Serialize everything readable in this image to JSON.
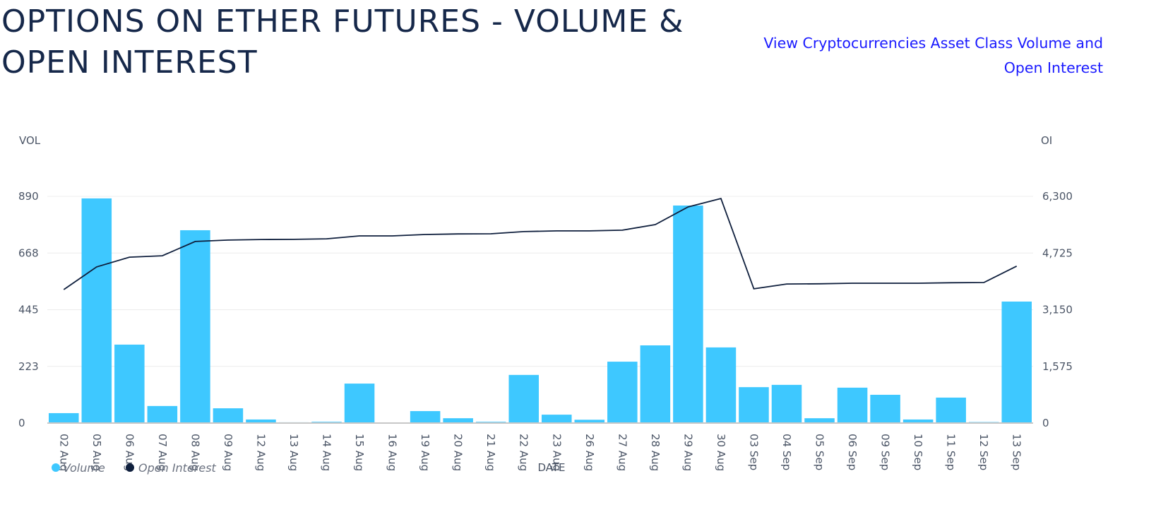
{
  "header": {
    "title": "OPTIONS ON ETHER FUTURES - VOLUME & OPEN INTEREST",
    "link_label": "View Cryptocurrencies Asset Class Volume and Open Interest"
  },
  "colors": {
    "volume": "#3ec8ff",
    "open_interest": "#0f1f3d",
    "title": "#16284a",
    "link": "#1a1aff",
    "gridline": "#ececec",
    "axis_text": "#4b5566"
  },
  "chart_data": {
    "type": "bar",
    "title": "OPTIONS ON ETHER FUTURES - VOLUME & OPEN INTEREST",
    "xlabel": "DATE",
    "ylabel": "VOL",
    "y2label": "OI",
    "ylim": [
      0,
      890
    ],
    "y2lim": [
      0,
      6300
    ],
    "yticks": [
      "0",
      "223",
      "445",
      "668",
      "890"
    ],
    "y2ticks": [
      "0",
      "1,575",
      "3,150",
      "4,725",
      "6,300"
    ],
    "grid": true,
    "legend_position": "bottom-left",
    "categories": [
      "02 Aug",
      "05 Aug",
      "06 Aug",
      "07 Aug",
      "08 Aug",
      "09 Aug",
      "12 Aug",
      "13 Aug",
      "14 Aug",
      "15 Aug",
      "16 Aug",
      "19 Aug",
      "20 Aug",
      "21 Aug",
      "22 Aug",
      "23 Aug",
      "26 Aug",
      "27 Aug",
      "28 Aug",
      "29 Aug",
      "30 Aug",
      "03 Sep",
      "04 Sep",
      "05 Sep",
      "06 Sep",
      "09 Sep",
      "10 Sep",
      "11 Sep",
      "12 Sep",
      "13 Sep"
    ],
    "series": [
      {
        "name": "Volume",
        "type": "bar",
        "axis": "left",
        "values": [
          39,
          882,
          308,
          67,
          757,
          58,
          14,
          3,
          5,
          155,
          2,
          47,
          19,
          5,
          189,
          33,
          13,
          241,
          305,
          854,
          297,
          141,
          150,
          19,
          139,
          111,
          14,
          100,
          4,
          477
        ]
      },
      {
        "name": "Open Interest",
        "type": "line",
        "axis": "right",
        "values": [
          3710,
          4340,
          4610,
          4650,
          5045,
          5085,
          5100,
          5105,
          5120,
          5200,
          5200,
          5240,
          5255,
          5260,
          5320,
          5340,
          5340,
          5360,
          5515,
          6005,
          6240,
          3730,
          3865,
          3870,
          3885,
          3885,
          3885,
          3900,
          3905,
          4360
        ]
      }
    ]
  }
}
